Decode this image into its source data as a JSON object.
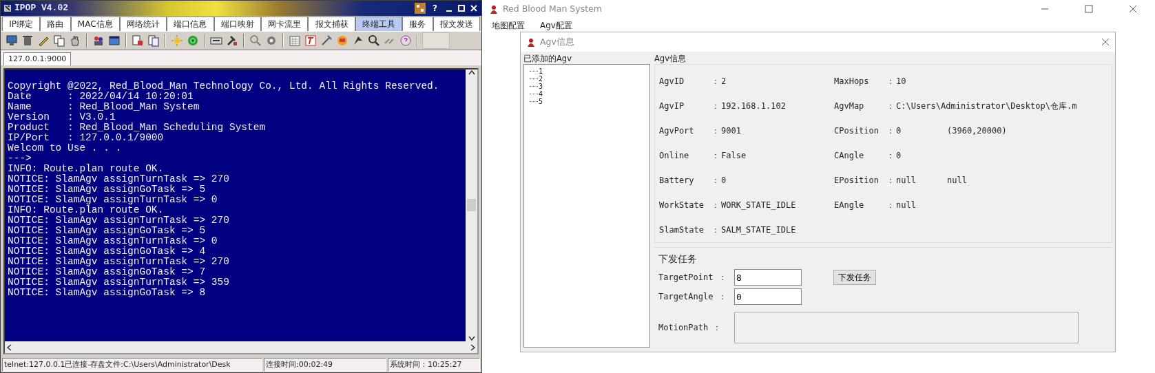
{
  "terminal_window": {
    "title": "IPOP V4.02",
    "title_buttons": [
      "?"
    ],
    "tabs": [
      {
        "label": "IP绑定",
        "selected": false
      },
      {
        "label": "路由",
        "selected": false
      },
      {
        "label": "MAC信息",
        "selected": false
      },
      {
        "label": "网络统计",
        "selected": false
      },
      {
        "label": "端口信息",
        "selected": false
      },
      {
        "label": "端口映射",
        "selected": false
      },
      {
        "label": "网卡流里",
        "selected": false
      },
      {
        "label": "报文捕获",
        "selected": false
      },
      {
        "label": "终端工具",
        "selected": true
      },
      {
        "label": "服务",
        "selected": false
      },
      {
        "label": "报文发送",
        "selected": false
      }
    ],
    "sessions": [
      {
        "label": "127.0.0.1:9000",
        "selected": true
      }
    ],
    "console_lines": [
      "Copyright @2022, Red_Blood_Man Technology Co., Ltd. All Rights Reserved.",
      "Date      : 2022/04/14 10:20:01",
      "Name      : Red_Blood_Man System",
      "Version   : V3.0.1",
      "Product   : Red_Blood_Man Scheduling System",
      "IP/Port   : 127.0.0.1/9000",
      "Welcom to Use . . .",
      "--->",
      "INFO: Route.plan route OK.",
      "NOTICE: SlamAgv assignTurnTask => 270",
      "NOTICE: SlamAgv assignGoTask => 5",
      "NOTICE: SlamAgv assignTurnTask => 0",
      "INFO: Route.plan route OK.",
      "NOTICE: SlamAgv assignTurnTask => 270",
      "NOTICE: SlamAgv assignGoTask => 5",
      "NOTICE: SlamAgv assignTurnTask => 0",
      "NOTICE: SlamAgv assignGoTask => 4",
      "NOTICE: SlamAgv assignTurnTask => 270",
      "NOTICE: SlamAgv assignGoTask => 7",
      "NOTICE: SlamAgv assignTurnTask => 359",
      "NOTICE: SlamAgv assignGoTask => 8"
    ],
    "status_bar": [
      "telnet:127.0.0.1已连接-存盘文件:C:\\Users\\Administrator\\Desk",
      "连接时间:00:02:49",
      "系统时间：10:25:27"
    ]
  },
  "main_window": {
    "title": "Red Blood Man System",
    "menu": [
      "地图配置",
      "Agv配置"
    ],
    "dialog": {
      "title": "Agv信息",
      "agv_list": {
        "title": "已添加的Agv",
        "items": [
          "1",
          "2",
          "3",
          "4",
          "5"
        ]
      },
      "agv_info": {
        "title": "Agv信息",
        "left_fields": [
          {
            "label": "AgvID",
            "separator": "：",
            "value": "2"
          },
          {
            "label": "AgvIP",
            "separator": "：",
            "value": "192.168.1.102"
          },
          {
            "label": "AgvPort",
            "separator": "：",
            "value": "9001"
          },
          {
            "label": "Online",
            "separator": "：",
            "value": "False"
          },
          {
            "label": "Battery",
            "separator": "：",
            "value": "0"
          },
          {
            "label": "WorkState",
            "separator": "：",
            "value": "WORK_STATE_IDLE"
          },
          {
            "label": "SlamState",
            "separator": "：",
            "value": "SALM_STATE_IDLE"
          }
        ],
        "right_fields": [
          {
            "label": "MaxHops",
            "separator": "：",
            "value": "10"
          },
          {
            "label": "AgvMap",
            "separator": "：",
            "value": "C:\\Users\\Administrator\\Desktop\\仓库.m"
          },
          {
            "label": "CPosition",
            "separator": "：",
            "value": "0",
            "extra": "(3960,20000)"
          },
          {
            "label": "CAngle",
            "separator": "：",
            "value": "0"
          },
          {
            "label": "EPosition",
            "separator": "：",
            "value": "null",
            "extra": "null"
          },
          {
            "label": "EAngle",
            "separator": "：",
            "value": "null"
          }
        ]
      },
      "task": {
        "title": "下发任务",
        "fields": [
          {
            "label": "TargetPoint",
            "separator": "：",
            "value": "8"
          },
          {
            "label": "TargetAngle",
            "separator": "：",
            "value": "0"
          }
        ],
        "motion_path": {
          "label": "MotionPath",
          "separator": "："
        },
        "button": "下发任务"
      }
    }
  }
}
